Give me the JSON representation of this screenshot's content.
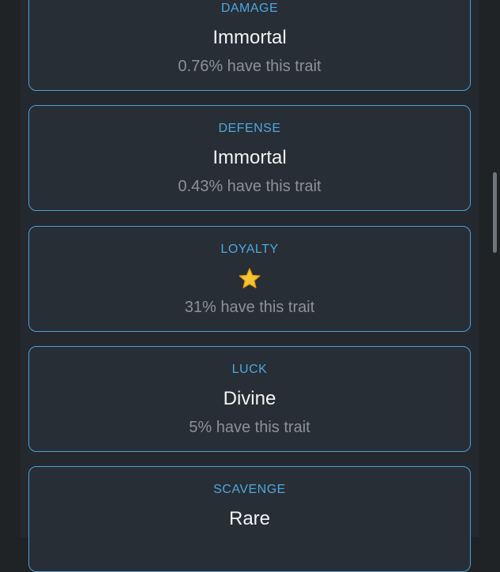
{
  "traits": [
    {
      "label": "DAMAGE",
      "value": "Immortal",
      "note": "0.76% have this trait"
    },
    {
      "label": "DEFENSE",
      "value": "Immortal",
      "note": "0.43% have this trait"
    },
    {
      "label": "LOYALTY",
      "value": "⭐",
      "value_icon": "star-icon",
      "note": "31% have this trait"
    },
    {
      "label": "LUCK",
      "value": "Divine",
      "note": "5% have this trait"
    },
    {
      "label": "SCAVENGE",
      "value": "Rare"
    }
  ],
  "colors": {
    "accent": "#4da7e0",
    "card_border": "#4f9fd6",
    "card_background": "#272e35",
    "panel_background": "#23292f",
    "page_background": "#1f2326",
    "value_text": "#f2f4f5",
    "note_text": "#8c9296",
    "star": "#f7c531"
  }
}
